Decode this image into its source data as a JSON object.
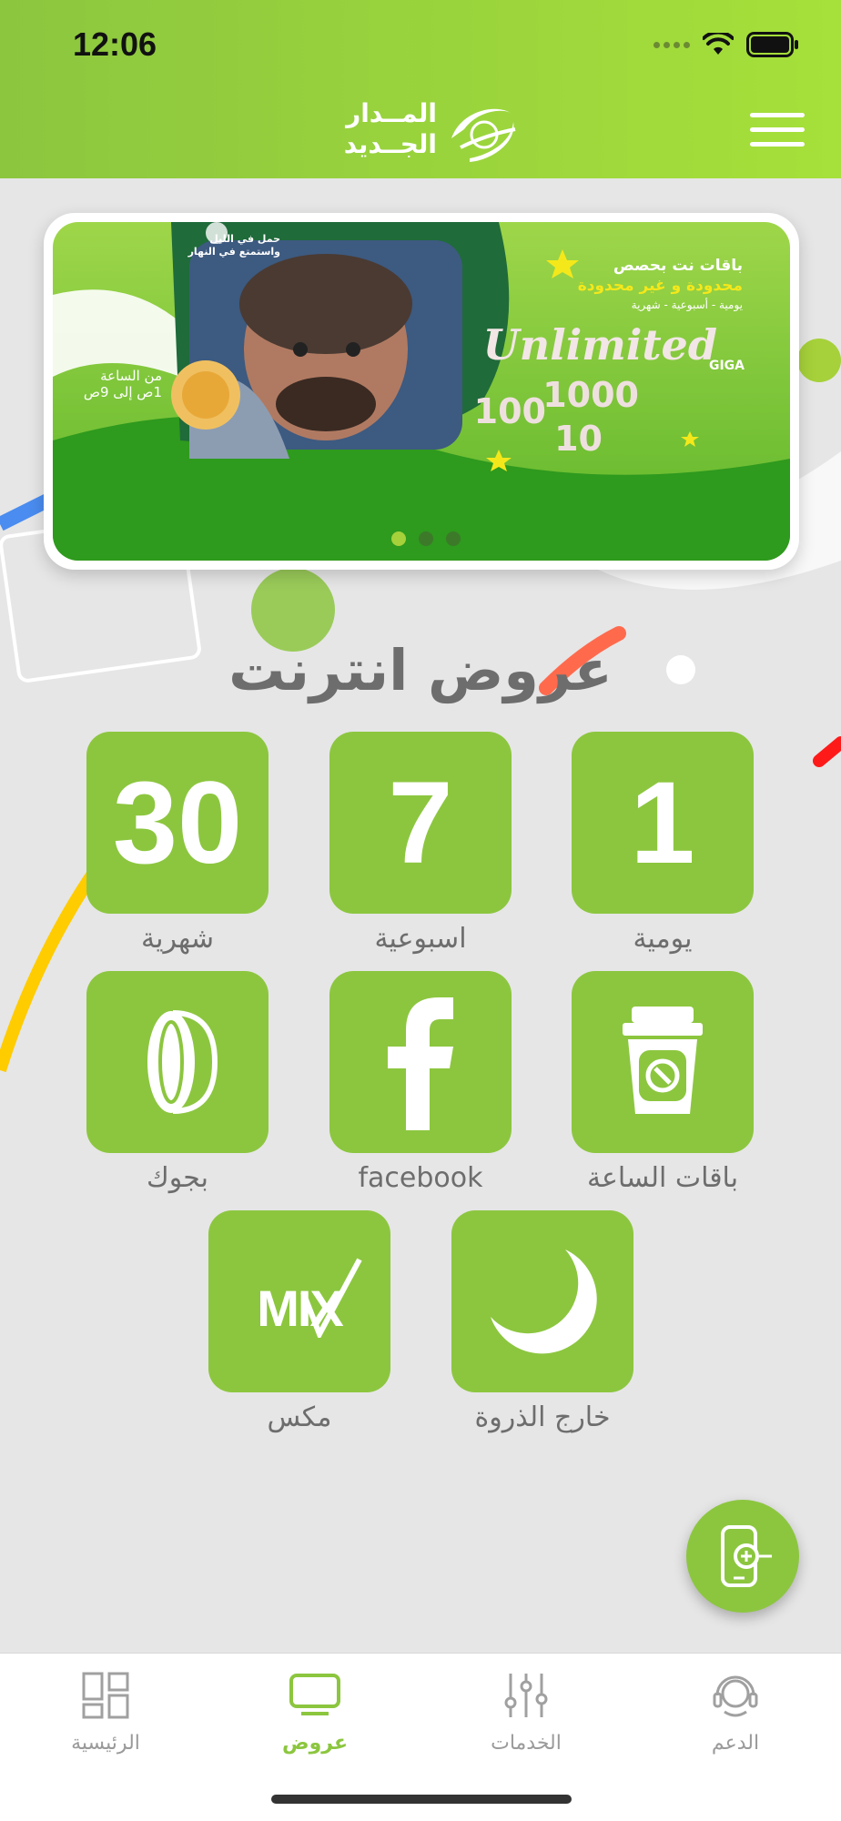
{
  "status_bar": {
    "time": "12:06"
  },
  "header": {
    "logo_line1": "المــدار",
    "logo_line2": "الجــديد"
  },
  "banner": {
    "line1": "باقات نت بحصص",
    "line2": "محدودة و غير محدودة",
    "line3": "يومية - أسبوعية - شهرية",
    "unlimited": "Unlimited",
    "giga": "GIGA",
    "b1000": "1000",
    "b100": "100",
    "b10": "10",
    "night_line1": "حمل في الليل",
    "night_line2": "واستمتع في النهار",
    "time_line1": "من الساعة",
    "time_line2": "1ص إلى 9ص",
    "dots_count": 3,
    "active_dot": 0
  },
  "section_title": "عروض انترنت",
  "tiles": [
    {
      "label": "يومية",
      "number": "1"
    },
    {
      "label": "اسبوعية",
      "number": "7"
    },
    {
      "label": "شهرية",
      "number": "30"
    },
    {
      "label": "باقات الساعة",
      "icon": "cup-icon"
    },
    {
      "label": "facebook",
      "icon": "facebook-icon"
    },
    {
      "label": "بجوك",
      "icon": "bejok-icon"
    },
    {
      "label": "خارج الذروة",
      "icon": "crescent-moon-icon"
    },
    {
      "label": "مكس",
      "icon": "mix-icon",
      "icon_text": "MIX"
    }
  ],
  "bottom_nav": [
    {
      "label": "الرئيسية",
      "icon": "grid-icon",
      "active": false
    },
    {
      "label": "عروض",
      "icon": "monitor-icon",
      "active": true
    },
    {
      "label": "الخدمات",
      "icon": "sliders-icon",
      "active": false
    },
    {
      "label": "الدعم",
      "icon": "headset-icon",
      "active": false
    }
  ],
  "colors": {
    "brand_green": "#8cc63f",
    "header_green_light": "#a6e03a",
    "text_gray": "#6d6d6d",
    "nav_inactive": "#9a9a9a",
    "banner_yellow": "#f5e81a"
  }
}
